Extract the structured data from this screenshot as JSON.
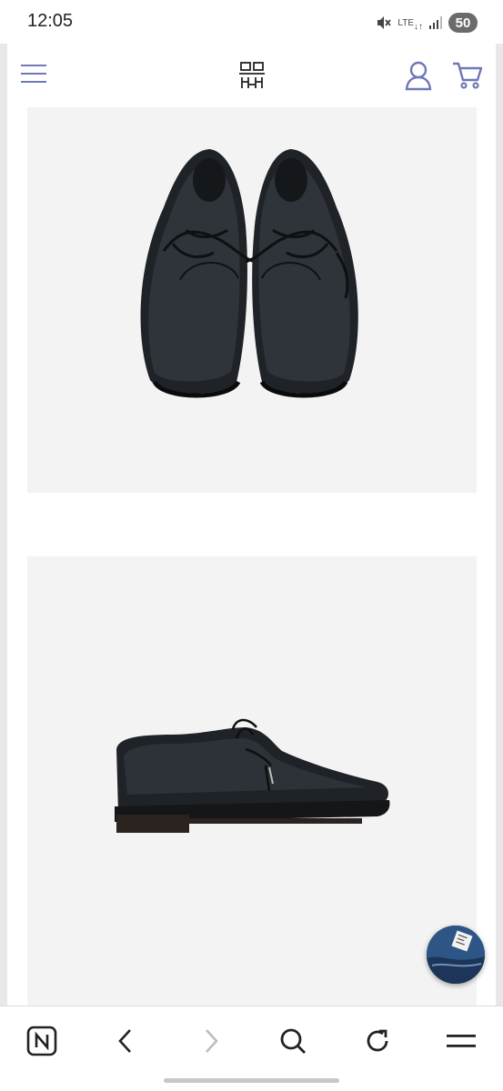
{
  "status_bar": {
    "time": "12:05",
    "network": "LTE",
    "battery": "50",
    "icons": [
      "mute-icon",
      "lte-icon",
      "signal-icon",
      "battery-icon"
    ]
  },
  "header": {
    "menu_icon": "hamburger-menu-icon",
    "logo": "brand-logo",
    "user_icon": "user-icon",
    "cart_icon": "cart-icon",
    "accent_color": "#6f78b8"
  },
  "products": {
    "images": [
      {
        "name": "product-image-top-view",
        "depicts": "pair-of-black-leather-derby-shoes-top-view"
      },
      {
        "name": "product-image-side-view",
        "depicts": "single-black-leather-derby-shoe-side-view"
      }
    ],
    "background": "#f3f3f3"
  },
  "floating_button": {
    "icon": "recent-product-thumbnail"
  },
  "browser_toolbar": {
    "buttons": [
      "naver-home-icon",
      "back-icon",
      "forward-icon",
      "search-icon",
      "reload-icon",
      "menu-icon"
    ]
  }
}
